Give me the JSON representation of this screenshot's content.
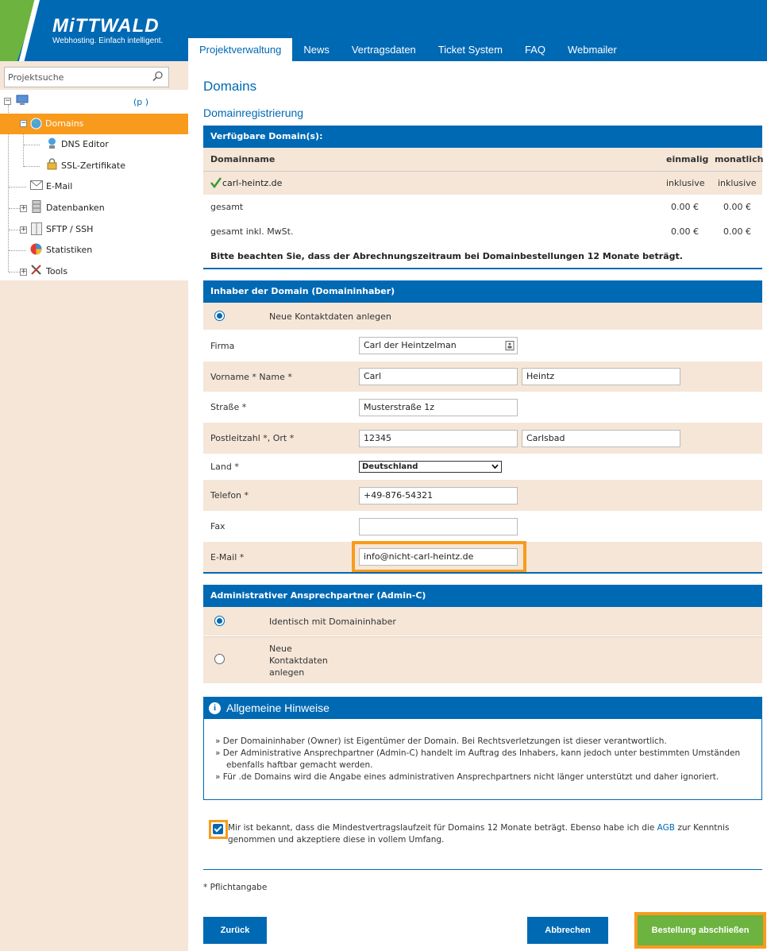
{
  "brand": {
    "name": "MiTTWALD",
    "tagline": "Webhosting. Einfach intelligent.",
    "colors": {
      "blue": "#0069b4",
      "green": "#6cb33f",
      "orange": "#f89b1c",
      "beige": "#f5e6d8"
    }
  },
  "nav": {
    "tabs": [
      {
        "label": "Projektverwaltung",
        "active": true
      },
      {
        "label": "News"
      },
      {
        "label": "Vertragsdaten"
      },
      {
        "label": "Ticket System"
      },
      {
        "label": "FAQ"
      },
      {
        "label": "Webmailer"
      }
    ]
  },
  "sidebar": {
    "search_placeholder": "Projektsuche",
    "root_label": "(p          )",
    "items": [
      {
        "label": "Domains",
        "icon": "globe-icon",
        "selected": true
      },
      {
        "label": "DNS Editor",
        "icon": "dns-icon"
      },
      {
        "label": "SSL-Zertifikate",
        "icon": "certificate-icon"
      },
      {
        "label": "E-Mail",
        "icon": "mail-icon"
      },
      {
        "label": "Datenbanken",
        "icon": "database-icon"
      },
      {
        "label": "SFTP / SSH",
        "icon": "server-icon"
      },
      {
        "label": "Statistiken",
        "icon": "pie-chart-icon"
      },
      {
        "label": "Tools",
        "icon": "tools-icon"
      }
    ]
  },
  "page": {
    "title": "Domains",
    "subtitle": "Domainregistrierung"
  },
  "available": {
    "header": "Verfügbare Domain(s):",
    "col_name": "Domainname",
    "col_once": "einmalig",
    "col_monthly": "monatlich",
    "domain": "carl-heintz.de",
    "domain_once": "inklusive",
    "domain_monthly": "inklusive",
    "total_label": "gesamt",
    "total_once": "0.00 €",
    "total_monthly": "0.00 €",
    "total_tax_label": "gesamt inkl. MwSt.",
    "total_tax_once": "0.00 €",
    "total_tax_monthly": "0.00 €",
    "note": "Bitte beachten Sie, dass der Abrechnungszeitraum bei Domainbestellungen 12 Monate beträgt."
  },
  "owner": {
    "header": "Inhaber der Domain (Domaininhaber)",
    "radio_new": "Neue Kontaktdaten anlegen",
    "firma_label": "Firma",
    "firma_value": "Carl der Heintzelman",
    "name_label": "Vorname * Name *",
    "first_name": "Carl",
    "last_name": "Heintz",
    "street_label": "Straße *",
    "street_value": "Musterstraße 1z",
    "zip_label": "Postleitzahl *, Ort *",
    "zip_value": "12345",
    "city_value": "Carlsbad",
    "country_label": "Land *",
    "country_value": "Deutschland",
    "phone_label": "Telefon *",
    "phone_value": "+49-876-54321",
    "fax_label": "Fax",
    "fax_value": "",
    "email_label": "E-Mail *",
    "email_value": "info@nicht-carl-heintz.de"
  },
  "admin": {
    "header": "Administrativer Ansprechpartner (Admin-C)",
    "radio_same": "Identisch mit Domaininhaber",
    "radio_new_1": "Neue",
    "radio_new_2": "Kontaktdaten",
    "radio_new_3": "anlegen"
  },
  "hints": {
    "header": "Allgemeine Hinweise",
    "items": [
      "» Der Domaininhaber (Owner) ist Eigentümer der Domain. Bei Rechtsverletzungen ist dieser verantwortlich.",
      "» Der Administrative Ansprechpartner (Admin-C) handelt im Auftrag des Inhabers, kann jedoch unter bestimmten Umständen ebenfalls haftbar gemacht werden.",
      "» Für .de Domains wird die Angabe eines administrativen Ansprechpartners nicht länger unterstützt und daher ignoriert."
    ]
  },
  "terms": {
    "text_before": "Mir ist bekannt, dass die Mindestvertragslaufzeit für Domains 12 Monate beträgt. Ebenso habe ich die ",
    "link": "AGB",
    "text_after": " zur Kenntnis genommen und akzeptiere diese in vollem Umfang.",
    "checked": true
  },
  "required_note": "* Pflichtangabe",
  "buttons": {
    "back": "Zurück",
    "cancel": "Abbrechen",
    "submit": "Bestellung abschließen"
  }
}
